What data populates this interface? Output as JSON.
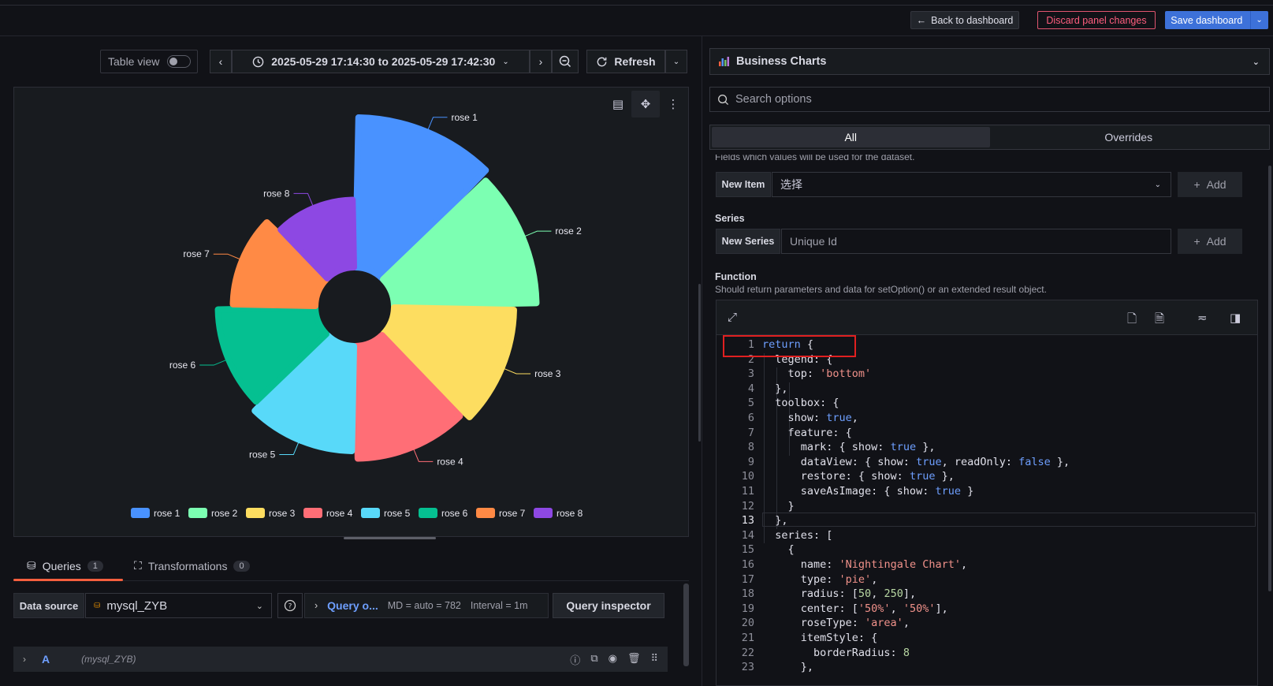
{
  "topbar": {
    "back_label": "Back to dashboard",
    "discard_label": "Discard panel changes",
    "save_label": "Save dashboard"
  },
  "toolbar": {
    "table_view_label": "Table view",
    "time_range": "2025-05-29 17:14:30 to 2025-05-29 17:42:30",
    "refresh_label": "Refresh"
  },
  "chart_data": {
    "type": "pie",
    "roseType": "area",
    "categories": [
      "rose 1",
      "rose 2",
      "rose 3",
      "rose 4",
      "rose 5",
      "rose 6",
      "rose 7",
      "rose 8"
    ],
    "values": [
      40,
      38,
      32,
      30,
      28,
      26,
      22,
      18
    ],
    "colors": [
      "#4992ff",
      "#7cffb2",
      "#fddd60",
      "#ff6e76",
      "#58d9f9",
      "#05c091",
      "#ff8a45",
      "#8d48e3"
    ],
    "radius": [
      50,
      250
    ],
    "legend_position": "bottom"
  },
  "queries": {
    "tab_queries": "Queries",
    "queries_count": "1",
    "tab_transformations": "Transformations",
    "transformations_count": "0",
    "data_source_label": "Data source",
    "data_source": "mysql_ZYB",
    "query_options_label": "Query o...",
    "md_info": "MD = auto = 782",
    "interval_info": "Interval = 1m",
    "inspector_label": "Query inspector",
    "row_name": "A",
    "row_datasource": "(mysql_ZYB)"
  },
  "options": {
    "visualization": "Business Charts",
    "search_placeholder": "Search options",
    "tab_all": "All",
    "tab_overrides": "Overrides",
    "fields_desc": "Fields which values will be used for the dataset.",
    "new_item_label": "New Item",
    "new_item_placeholder": "选择",
    "add_label": "Add",
    "series_title": "Series",
    "new_series_label": "New Series",
    "series_placeholder": "Unique Id",
    "function_title": "Function",
    "function_desc": "Should return parameters and data for setOption() or an extended result object."
  }
}
